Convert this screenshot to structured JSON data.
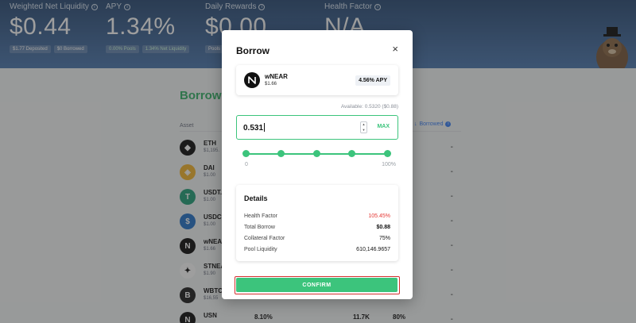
{
  "stats": [
    {
      "label": "Weighted Net Liquidity",
      "value": "$0.44",
      "pills": [
        "$1.77 Deposited",
        "$0 Borrowed"
      ]
    },
    {
      "label": "APY",
      "value": "1.34%",
      "pills": [
        "0.00% Pools",
        "1.34% Net Liquidity"
      ]
    },
    {
      "label": "Daily Rewards",
      "value": "$0.00",
      "pills": [
        "Pools"
      ]
    },
    {
      "label": "Health Factor",
      "value": "N/A",
      "pills": []
    }
  ],
  "page": {
    "title": "Borrow A",
    "col_asset": "Asset",
    "col_borrowed": "Borrowed",
    "assets": [
      {
        "name": "ETH",
        "price": "$1,195.",
        "icon": "eth-icon",
        "color": "#111111",
        "glyph": "◆"
      },
      {
        "name": "DAI",
        "price": "$1.00",
        "icon": "dai-icon",
        "color": "#f4b731",
        "glyph": "◈"
      },
      {
        "name": "USDT.e",
        "price": "$1.00",
        "icon": "usdt-icon",
        "color": "#26a17b",
        "glyph": "T"
      },
      {
        "name": "USDC",
        "price": "$1.00",
        "icon": "usdc-icon",
        "color": "#2775ca",
        "glyph": "$"
      },
      {
        "name": "wNEAR",
        "price": "$1.66",
        "icon": "near-icon",
        "color": "#111111",
        "glyph": "N"
      },
      {
        "name": "STNEA",
        "price": "$1.90",
        "icon": "stnear-icon",
        "color": "#ffffff",
        "glyph": "✦"
      },
      {
        "name": "WBTC",
        "price": "$16,55",
        "icon": "wbtc-icon",
        "color": "#222222",
        "glyph": "B"
      },
      {
        "name": "USN",
        "price": "",
        "icon": "usn-icon",
        "color": "#111111",
        "glyph": "N",
        "c1": "8.10%",
        "c2": "11.7K",
        "c3": "80%"
      }
    ],
    "dash": "-"
  },
  "modal": {
    "title": "Borrow",
    "close": "×",
    "token": {
      "name": "wNEAR",
      "price": "$1.66",
      "apy": "4.56% APY"
    },
    "available": "Available: 0.5320 ($0.88)",
    "amount": "0.531",
    "max_label": "MAX",
    "slider_min": "0",
    "slider_max": "100%",
    "slider_points": [
      0,
      0.25,
      0.5,
      0.75,
      1
    ],
    "details_title": "Details",
    "details": [
      {
        "label": "Health Factor",
        "value": "105.45%",
        "style": "red"
      },
      {
        "label": "Total Borrow",
        "value": "$0.88",
        "style": "bold"
      },
      {
        "label": "Collateral Factor",
        "value": "75%",
        "style": ""
      },
      {
        "label": "Pool Liquidity",
        "value": "610,146.9657",
        "style": ""
      }
    ],
    "confirm_label": "CONFIRM"
  },
  "colors": {
    "accent_green": "#3cc47c",
    "danger_red": "#e53935",
    "hero_blue": "#3f6596"
  }
}
